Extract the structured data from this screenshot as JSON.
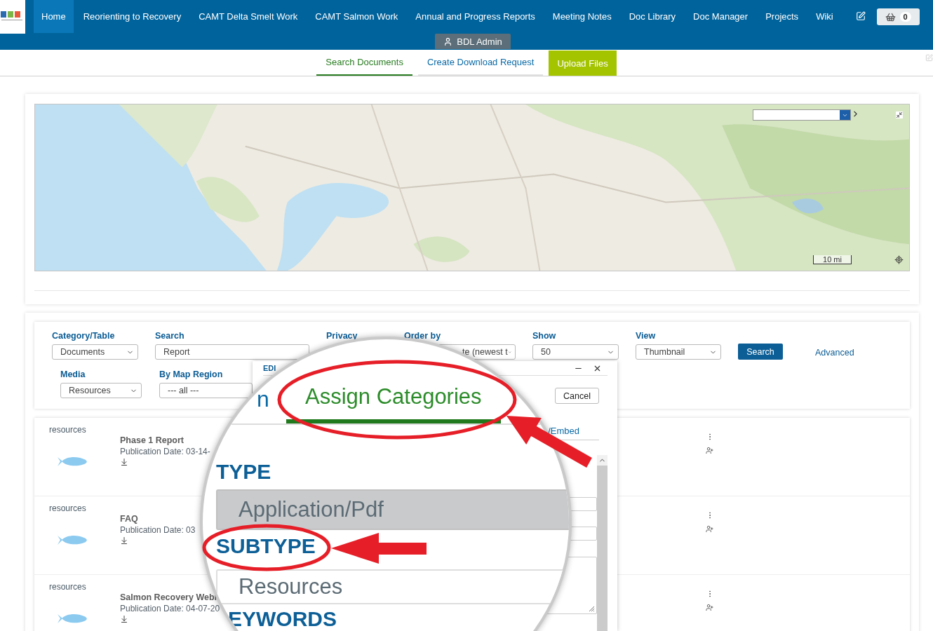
{
  "header": {
    "nav": [
      {
        "label": "Home",
        "selected": true
      },
      {
        "label": "Reorienting to Recovery",
        "selected": false
      },
      {
        "label": "CAMT Delta Smelt Work",
        "selected": false
      },
      {
        "label": "CAMT Salmon Work",
        "selected": false
      },
      {
        "label": "Annual and Progress Reports",
        "selected": false
      },
      {
        "label": "Meeting Notes",
        "selected": false
      },
      {
        "label": "Doc Library",
        "selected": false
      },
      {
        "label": "Doc Manager",
        "selected": false
      },
      {
        "label": "Projects",
        "selected": false
      },
      {
        "label": "Wiki",
        "selected": false
      }
    ],
    "cart_count": "0",
    "user_badge": "BDL Admin"
  },
  "subnav": [
    {
      "label": "Search Documents",
      "kind": "tab",
      "selected": true
    },
    {
      "label": "Create Download Request",
      "kind": "tab",
      "selected": false
    },
    {
      "label": "Upload Files",
      "kind": "button",
      "selected": false
    }
  ],
  "map": {
    "scale": "10 mi"
  },
  "filters": [
    {
      "label": "Category/Table",
      "value": "Documents",
      "kind": "select"
    },
    {
      "label": "Search",
      "value": "Report",
      "kind": "input"
    },
    {
      "label": "Privacy",
      "kind": "label"
    },
    {
      "label": "Order by",
      "value": "te (newest t",
      "kind": "select"
    },
    {
      "label": "Show",
      "value": "50",
      "kind": "select"
    },
    {
      "label": "View",
      "value": "Thumbnail",
      "kind": "select"
    }
  ],
  "search_button": "Search",
  "advanced_link": "Advanced",
  "filters_row2": [
    {
      "label": "Media",
      "value": "Resources"
    },
    {
      "label": "By Map Region",
      "value": "--- all ---"
    }
  ],
  "results": [
    {
      "category": "resources",
      "title": "Phase 1 Report",
      "date": "Publication Date: 03-14-"
    },
    {
      "category": "resources",
      "title": "FAQ",
      "date": "Publication Date: 03"
    },
    {
      "category": "resources",
      "title": "Salmon Recovery Webi",
      "date": "Publication Date: 04-07-20"
    }
  ],
  "dialog": {
    "heading": "EDI",
    "cancel": "Cancel",
    "tab_fragment": "/Embed"
  },
  "magnifier": {
    "tab_fragment": "n",
    "active_tab": "Assign Categories",
    "fields": [
      {
        "label": "TYPE",
        "value": "Application/Pdf",
        "selected": true
      },
      {
        "label": "SUBTYPE",
        "value": "Resources",
        "selected": false
      }
    ],
    "next_label": "EYWORDS"
  }
}
